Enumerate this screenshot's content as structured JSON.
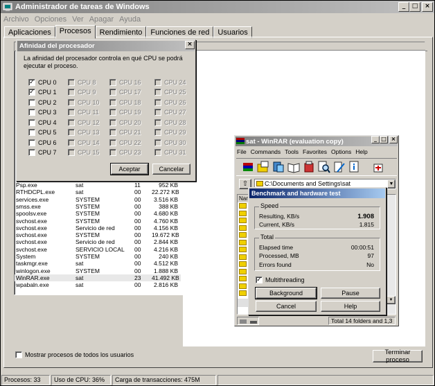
{
  "taskmgr": {
    "title": "Administrador de tareas de Windows",
    "menu": [
      "Archivo",
      "Opciones",
      "Ver",
      "Apagar",
      "Ayuda"
    ],
    "tabs": [
      "Aplicaciones",
      "Procesos",
      "Rendimiento",
      "Funciones de red",
      "Usuarios"
    ],
    "active_tab": "Procesos",
    "processes": [
      {
        "name": "Psp.exe",
        "user": "sat",
        "cpu": "11",
        "mem": "952 KB"
      },
      {
        "name": "RTHDCPL.exe",
        "user": "sat",
        "cpu": "00",
        "mem": "22.272 KB"
      },
      {
        "name": "services.exe",
        "user": "SYSTEM",
        "cpu": "00",
        "mem": "3.516 KB"
      },
      {
        "name": "smss.exe",
        "user": "SYSTEM",
        "cpu": "00",
        "mem": "388 KB"
      },
      {
        "name": "spoolsv.exe",
        "user": "SYSTEM",
        "cpu": "00",
        "mem": "4.680 KB"
      },
      {
        "name": "svchost.exe",
        "user": "SYSTEM",
        "cpu": "00",
        "mem": "4.760 KB"
      },
      {
        "name": "svchost.exe",
        "user": "Servicio de red",
        "cpu": "00",
        "mem": "4.156 KB"
      },
      {
        "name": "svchost.exe",
        "user": "SYSTEM",
        "cpu": "00",
        "mem": "19.672 KB"
      },
      {
        "name": "svchost.exe",
        "user": "Servicio de red",
        "cpu": "00",
        "mem": "2.844 KB"
      },
      {
        "name": "svchost.exe",
        "user": "SERVICIO LOCAL",
        "cpu": "00",
        "mem": "4.216 KB"
      },
      {
        "name": "System",
        "user": "SYSTEM",
        "cpu": "00",
        "mem": "240 KB"
      },
      {
        "name": "taskmgr.exe",
        "user": "sat",
        "cpu": "00",
        "mem": "4.512 KB"
      },
      {
        "name": "winlogon.exe",
        "user": "SYSTEM",
        "cpu": "00",
        "mem": "1.888 KB"
      },
      {
        "name": "WinRAR.exe",
        "user": "sat",
        "cpu": "23",
        "mem": "41.492 KB",
        "selected": true
      },
      {
        "name": "wpabaln.exe",
        "user": "sat",
        "cpu": "00",
        "mem": "2.816 KB"
      }
    ],
    "show_all_label": "Mostrar procesos de todos los usuarios",
    "end_process_label": "Terminar proceso",
    "status": {
      "processes": "Procesos: 33",
      "cpu": "Uso de CPU: 36%",
      "commit": "Carga de transacciones: 475M"
    }
  },
  "affinity": {
    "title": "Afinidad del procesador",
    "description": "La afinidad del procesador controla en qué CPU se podrá ejecutar el proceso.",
    "columns": [
      [
        {
          "label": "CPU 0",
          "checked": true,
          "enabled": true
        },
        {
          "label": "CPU 1",
          "checked": true,
          "enabled": true
        },
        {
          "label": "CPU 2",
          "checked": false,
          "enabled": true
        },
        {
          "label": "CPU 3",
          "checked": false,
          "enabled": true
        },
        {
          "label": "CPU 4",
          "checked": false,
          "enabled": true
        },
        {
          "label": "CPU 5",
          "checked": false,
          "enabled": true
        },
        {
          "label": "CPU 6",
          "checked": false,
          "enabled": true
        },
        {
          "label": "CPU 7",
          "checked": false,
          "enabled": true
        }
      ],
      [
        {
          "label": "CPU 8",
          "checked": false,
          "enabled": false
        },
        {
          "label": "CPU 9",
          "checked": false,
          "enabled": false
        },
        {
          "label": "CPU 10",
          "checked": false,
          "enabled": false
        },
        {
          "label": "CPU 11",
          "checked": false,
          "enabled": false
        },
        {
          "label": "CPU 12",
          "checked": false,
          "enabled": false
        },
        {
          "label": "CPU 13",
          "checked": false,
          "enabled": false
        },
        {
          "label": "CPU 14",
          "checked": false,
          "enabled": false
        },
        {
          "label": "CPU 15",
          "checked": false,
          "enabled": false
        }
      ],
      [
        {
          "label": "CPU 16",
          "checked": false,
          "enabled": false
        },
        {
          "label": "CPU 17",
          "checked": false,
          "enabled": false
        },
        {
          "label": "CPU 18",
          "checked": false,
          "enabled": false
        },
        {
          "label": "CPU 19",
          "checked": false,
          "enabled": false
        },
        {
          "label": "CPU 20",
          "checked": false,
          "enabled": false
        },
        {
          "label": "CPU 21",
          "checked": false,
          "enabled": false
        },
        {
          "label": "CPU 22",
          "checked": false,
          "enabled": false
        },
        {
          "label": "CPU 23",
          "checked": false,
          "enabled": false
        }
      ],
      [
        {
          "label": "CPU 24",
          "checked": false,
          "enabled": false
        },
        {
          "label": "CPU 25",
          "checked": false,
          "enabled": false
        },
        {
          "label": "CPU 26",
          "checked": false,
          "enabled": false
        },
        {
          "label": "CPU 27",
          "checked": false,
          "enabled": false
        },
        {
          "label": "CPU 28",
          "checked": false,
          "enabled": false
        },
        {
          "label": "CPU 29",
          "checked": false,
          "enabled": false
        },
        {
          "label": "CPU 30",
          "checked": false,
          "enabled": false
        },
        {
          "label": "CPU 31",
          "checked": false,
          "enabled": false
        }
      ]
    ],
    "accept_label": "Aceptar",
    "cancel_label": "Cancelar",
    "close_glyph": "×"
  },
  "winrar": {
    "title": "sat - WinRAR (evaluation copy)",
    "menu": [
      "File",
      "Commands",
      "Tools",
      "Favorites",
      "Options",
      "Help"
    ],
    "path": "C:\\Documents and Settings\\sat",
    "list_header": "Nam",
    "status_text": "Total 14 folders and 1,3",
    "benchmark": {
      "title": "Benchmark and hardware test",
      "speed_group": "Speed",
      "resulting_label": "Resulting, KB/s",
      "resulting_value": "1.908",
      "current_label": "Current, KB/s",
      "current_value": "1.815",
      "total_group": "Total",
      "elapsed_label": "Elapsed time",
      "elapsed_value": "00:00:51",
      "processed_label": "Processed, MB",
      "processed_value": "97",
      "errors_label": "Errors found",
      "errors_value": "No",
      "multithreading_label": "Multithreading",
      "multithreading_checked": true,
      "background_label": "Background",
      "pause_label": "Pause",
      "cancel_label": "Cancel",
      "help_label": "Help"
    }
  },
  "colors": {
    "face": "#d4d0c8",
    "active_title": "#0a246a",
    "inactive_title": "#808080"
  }
}
